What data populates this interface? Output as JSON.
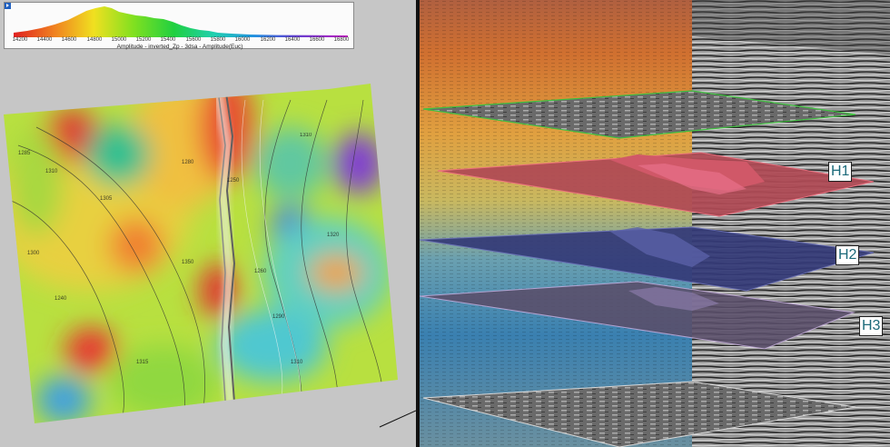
{
  "colorbar": {
    "ticks": [
      "14200",
      "14400",
      "14600",
      "14800",
      "15000",
      "15200",
      "15400",
      "15600",
      "15800",
      "16000",
      "16200",
      "16400",
      "16600",
      "16800"
    ],
    "title": "Amplitude - inverted_Zp - 3dsa - Amplitude(Euc)"
  },
  "horizons": [
    {
      "label": "H1",
      "color": "#c05060"
    },
    {
      "label": "H2",
      "color": "#3a3f7a"
    },
    {
      "label": "H3",
      "color": "#6a5c7a"
    }
  ],
  "contour_labels": [
    "1285",
    "1310",
    "1300",
    "1350",
    "1250",
    "1260",
    "1310",
    "1315",
    "1320",
    "1280",
    "1310",
    "1305",
    "1240",
    "1290"
  ],
  "icons": {
    "toggle": "expand-triangle-icon"
  }
}
